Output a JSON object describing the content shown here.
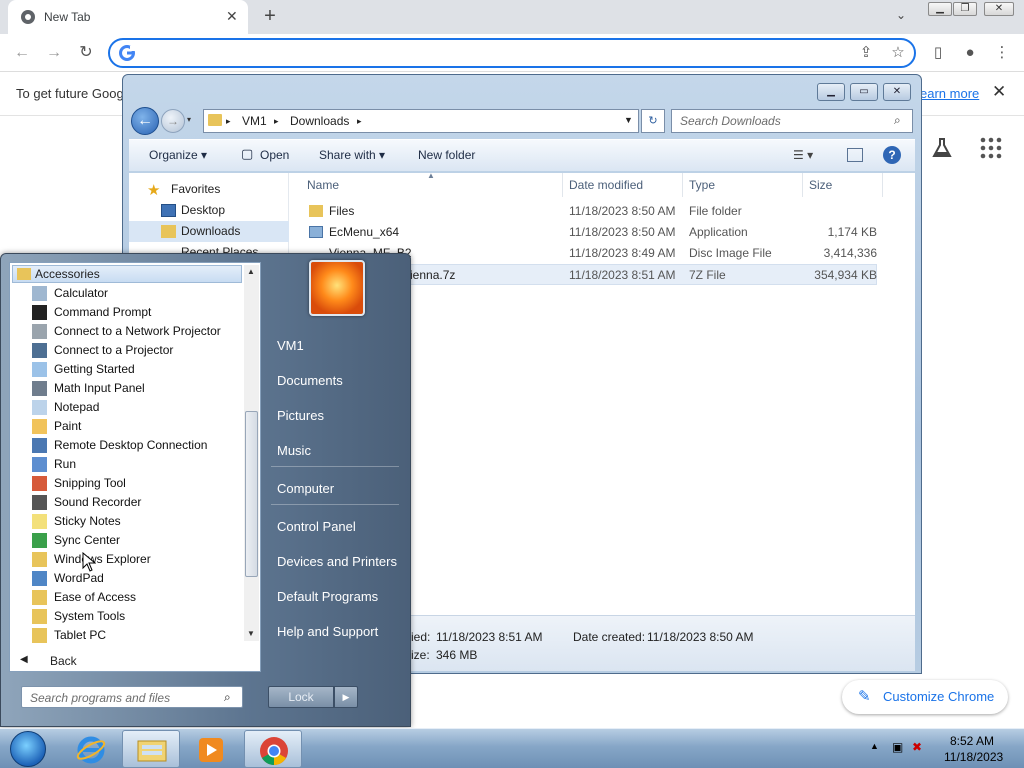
{
  "chrome": {
    "tab_title": "New Tab",
    "tab_close": "✕",
    "new_tab": "+",
    "tab_search": "⌄",
    "omnibox_value": "",
    "infobar_text": "To get future Goog",
    "infobar_link": "earn more",
    "infobar_close": "✕",
    "customize_label": "Customize Chrome"
  },
  "explorer": {
    "address": {
      "seg1": "VM1",
      "seg2": "Downloads"
    },
    "search_placeholder": "Search Downloads",
    "commands": {
      "organize": "Organize ▾",
      "open": "Open",
      "share": "Share with ▾",
      "new_folder": "New folder"
    },
    "nav": {
      "favorites": "Favorites",
      "desktop": "Desktop",
      "downloads": "Downloads",
      "recent": "Recent Places"
    },
    "columns": {
      "name": "Name",
      "date": "Date modified",
      "type": "Type",
      "size": "Size"
    },
    "files": [
      {
        "name": "Files",
        "date": "11/18/2023 8:50 AM",
        "type": "File folder",
        "size": ""
      },
      {
        "name": "EcMenu_x64",
        "date": "11/18/2023 8:50 AM",
        "type": "Application",
        "size": "1,174 KB"
      },
      {
        "name": "Vienna_MF_B2",
        "date": "11/18/2023 8:49 AM",
        "type": "Disc Image File",
        "size": "3,414,336 KB"
      },
      {
        "name": "ienna.7z",
        "date": "11/18/2023 8:51 AM",
        "type": "7Z File",
        "size": "354,934 KB"
      }
    ],
    "details": {
      "modified_label": "ied:",
      "modified_value": "11/18/2023 8:51 AM",
      "created_label": "Date created:",
      "created_value": "11/18/2023 8:50 AM",
      "size_label": "ize:",
      "size_value": "346 MB"
    }
  },
  "start_menu": {
    "header": "Accessories",
    "programs": [
      "Calculator",
      "Command Prompt",
      "Connect to a Network Projector",
      "Connect to a Projector",
      "Getting Started",
      "Math Input Panel",
      "Notepad",
      "Paint",
      "Remote Desktop Connection",
      "Run",
      "Snipping Tool",
      "Sound Recorder",
      "Sticky Notes",
      "Sync Center",
      "Windows Explorer",
      "WordPad",
      "Ease of Access",
      "System Tools",
      "Tablet PC"
    ],
    "back": "Back",
    "search_placeholder": "Search programs and files",
    "right_links": [
      "VM1",
      "Documents",
      "Pictures",
      "Music",
      "Computer",
      "Control Panel",
      "Devices and Printers",
      "Default Programs",
      "Help and Support"
    ],
    "lock": "Lock"
  },
  "taskbar": {
    "time": "8:52 AM",
    "date": "11/18/2023"
  },
  "colors": {
    "accent": "#1a73e8",
    "selection": "#d9e6f5",
    "taskbar": "#86a6c7"
  }
}
